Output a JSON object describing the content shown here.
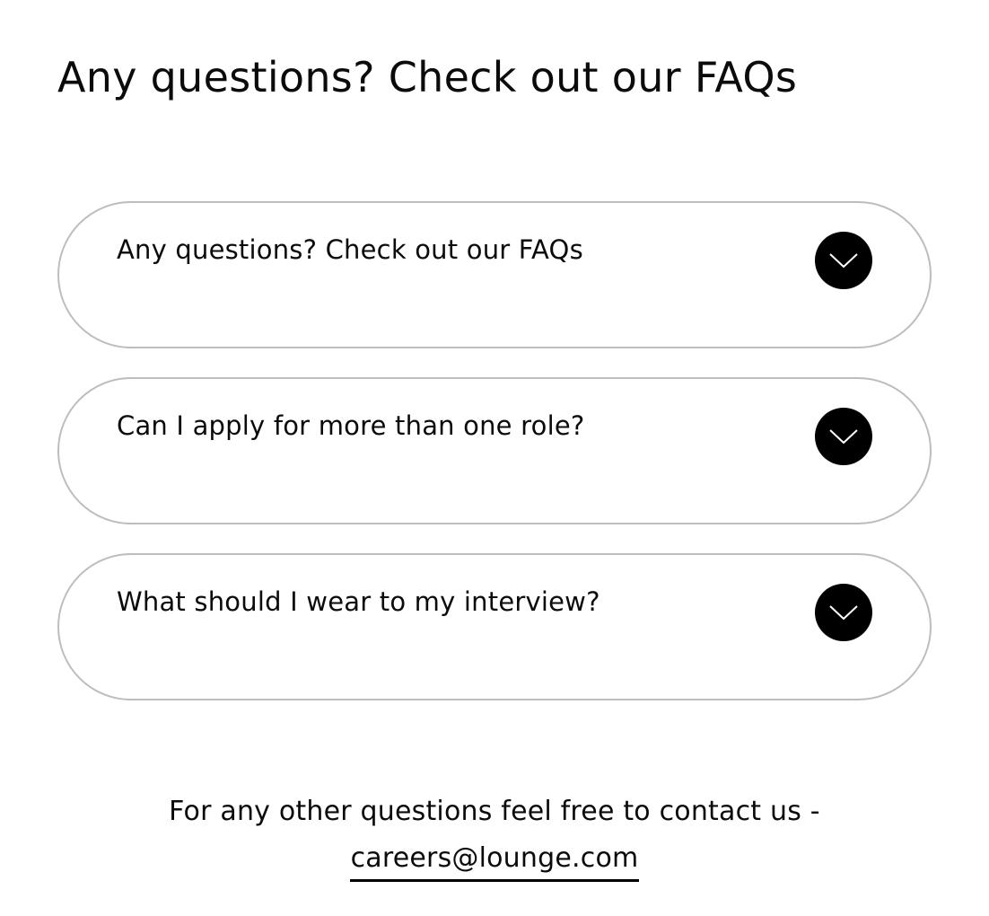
{
  "page": {
    "title": "Any questions? Check out our FAQs"
  },
  "faq": {
    "items": [
      {
        "question": "Any questions? Check out our FAQs",
        "expanded": false
      },
      {
        "question": "Can I apply for more than one role?",
        "expanded": false
      },
      {
        "question": "What should I wear to my interview?",
        "expanded": false
      }
    ],
    "toggle_icon": "chevron-down-icon"
  },
  "contact": {
    "text": "For any other questions feel free to contact us -",
    "email": "careers@lounge.com"
  },
  "colors": {
    "text": "#0b0b0b",
    "item_border": "#bdbdbd",
    "toggle_background": "#000000",
    "toggle_icon": "#ffffff"
  }
}
